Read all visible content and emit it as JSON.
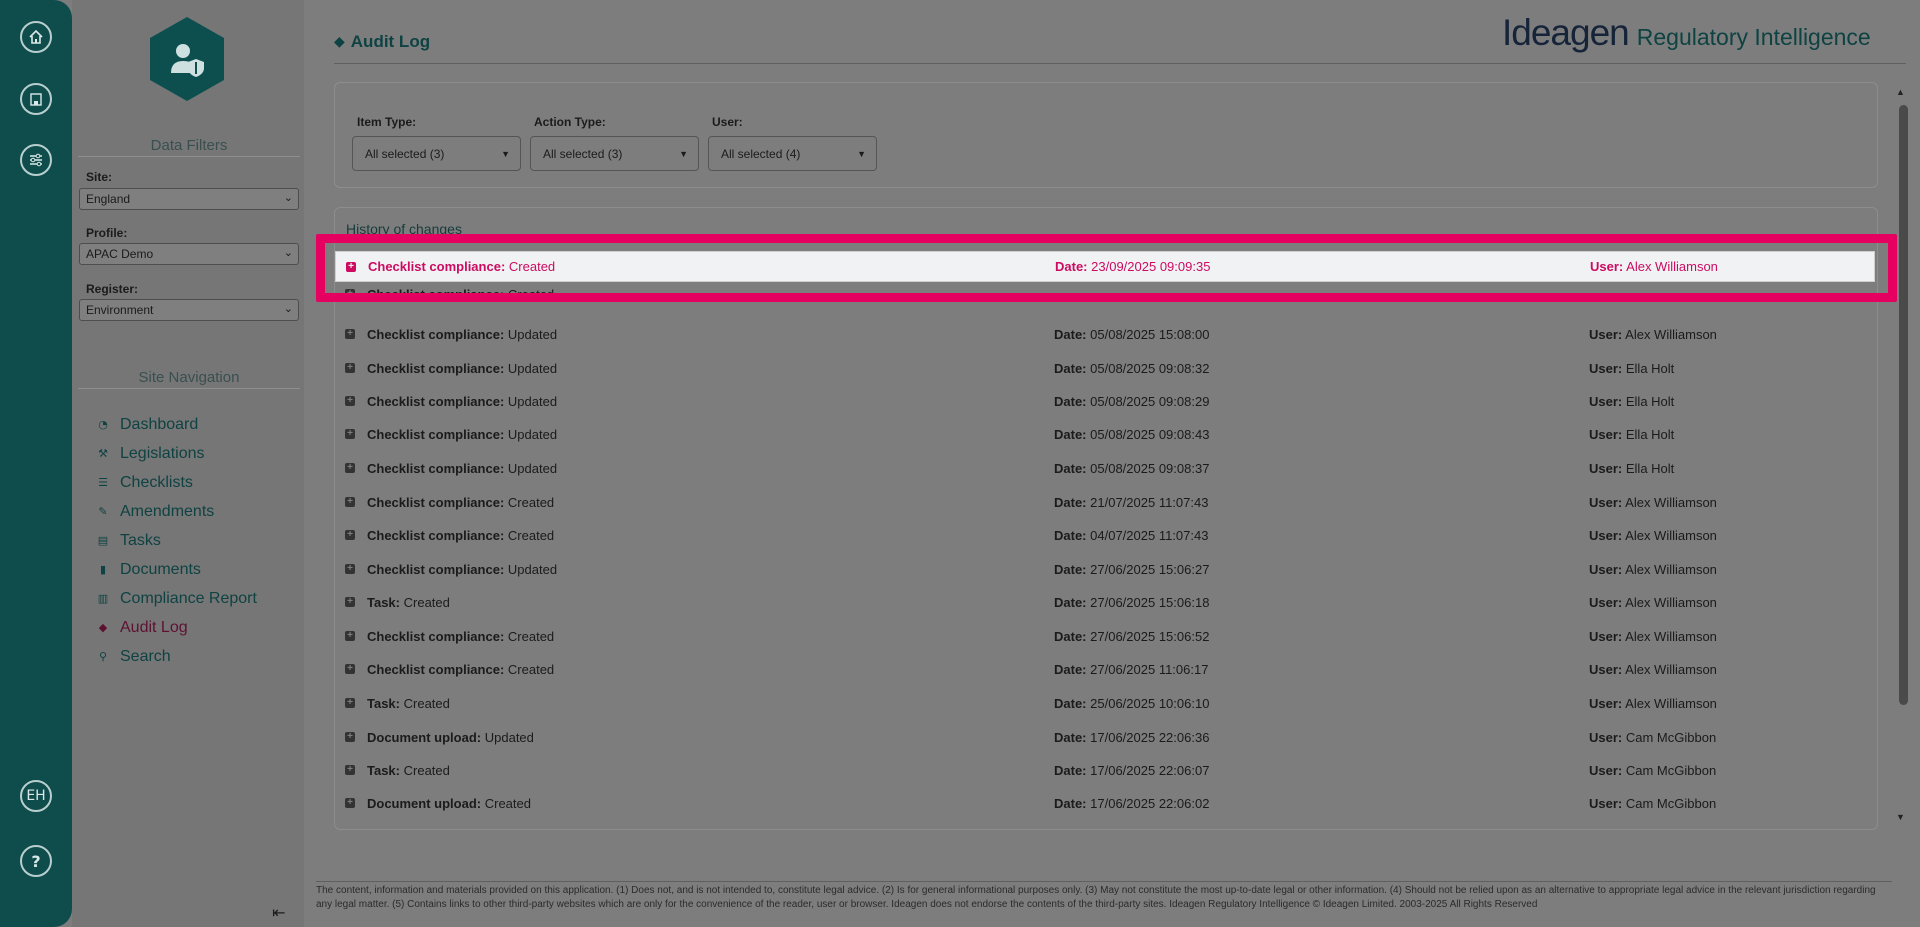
{
  "rail": {
    "home_icon": "home-icon",
    "site_icon": "building-icon",
    "filters_icon": "sliders-icon",
    "user_initials": "EH",
    "help_label": "?"
  },
  "sidebar": {
    "data_filters_title": "Data Filters",
    "site_label": "Site:",
    "site_value": "England",
    "profile_label": "Profile:",
    "profile_value": "APAC Demo",
    "register_label": "Register:",
    "register_value": "Environment",
    "nav_title": "Site Navigation",
    "nav": [
      {
        "label": "Dashboard",
        "icon": "dashboard-icon"
      },
      {
        "label": "Legislations",
        "icon": "gavel-icon"
      },
      {
        "label": "Checklists",
        "icon": "list-icon"
      },
      {
        "label": "Amendments",
        "icon": "edit-icon"
      },
      {
        "label": "Tasks",
        "icon": "tasks-icon"
      },
      {
        "label": "Documents",
        "icon": "file-icon"
      },
      {
        "label": "Compliance Report",
        "icon": "bar-chart-icon"
      },
      {
        "label": "Audit Log",
        "icon": "tags-icon"
      },
      {
        "label": "Search",
        "icon": "search-icon"
      }
    ],
    "collapse_glyph": "⇤"
  },
  "header": {
    "title": "Audit Log",
    "brand_main": "Ideagen",
    "brand_sub": "Regulatory Intelligence"
  },
  "filters": {
    "item_type_label": "Item Type:",
    "item_type_value": "All selected (3)",
    "action_type_label": "Action Type:",
    "action_type_value": "All selected (3)",
    "user_label": "User:",
    "user_value": "All selected (4)"
  },
  "history": {
    "title": "History of changes",
    "date_prefix": "Date:",
    "user_prefix": "User:",
    "rows": [
      {
        "item": "Checklist compliance:",
        "action": "Created",
        "date": "23/09/2025 09:09:35",
        "user": "Alex Williamson"
      },
      {
        "item": "Checklist compliance:",
        "action": "Created",
        "date": "",
        "user": ""
      },
      {
        "item": "Checklist compliance:",
        "action": "Updated",
        "date": "05/08/2025 15:08:00",
        "user": "Alex Williamson"
      },
      {
        "item": "Checklist compliance:",
        "action": "Updated",
        "date": "05/08/2025 09:08:32",
        "user": "Ella Holt"
      },
      {
        "item": "Checklist compliance:",
        "action": "Updated",
        "date": "05/08/2025 09:08:29",
        "user": "Ella Holt"
      },
      {
        "item": "Checklist compliance:",
        "action": "Updated",
        "date": "05/08/2025 09:08:43",
        "user": "Ella Holt"
      },
      {
        "item": "Checklist compliance:",
        "action": "Updated",
        "date": "05/08/2025 09:08:37",
        "user": "Ella Holt"
      },
      {
        "item": "Checklist compliance:",
        "action": "Created",
        "date": "21/07/2025 11:07:43",
        "user": "Alex Williamson"
      },
      {
        "item": "Checklist compliance:",
        "action": "Created",
        "date": "04/07/2025 11:07:43",
        "user": "Alex Williamson"
      },
      {
        "item": "Checklist compliance:",
        "action": "Updated",
        "date": "27/06/2025 15:06:27",
        "user": "Alex Williamson"
      },
      {
        "item": "Task:",
        "action": "Created",
        "date": "27/06/2025 15:06:18",
        "user": "Alex Williamson"
      },
      {
        "item": "Checklist compliance:",
        "action": "Created",
        "date": "27/06/2025 15:06:52",
        "user": "Alex Williamson"
      },
      {
        "item": "Checklist compliance:",
        "action": "Created",
        "date": "27/06/2025 11:06:17",
        "user": "Alex Williamson"
      },
      {
        "item": "Task:",
        "action": "Created",
        "date": "25/06/2025 10:06:10",
        "user": "Alex Williamson"
      },
      {
        "item": "Document upload:",
        "action": "Updated",
        "date": "17/06/2025 22:06:36",
        "user": "Cam McGibbon"
      },
      {
        "item": "Task:",
        "action": "Created",
        "date": "17/06/2025 22:06:07",
        "user": "Cam McGibbon"
      },
      {
        "item": "Document upload:",
        "action": "Created",
        "date": "17/06/2025 22:06:02",
        "user": "Cam McGibbon"
      }
    ]
  },
  "footer": {
    "disclaimer": "The content, information and materials provided on this application. (1) Does not, and is not intended to, constitute legal advice. (2) Is for general informational purposes only. (3) May not constitute the most up-to-date legal or other information. (4) Should not be relied upon as an alternative to appropriate legal advice in the relevant jurisdiction regarding any legal matter. (5) Contains links to other third-party websites which are only for the convenience of the reader, user or browser. Ideagen does not endorse the contents of the third-party sites. Ideagen Regulatory Intelligence © Ideagen Limited. 2003-2025 All Rights Reserved"
  },
  "colors": {
    "rail": "#0f4c4c",
    "accent_teal": "#0f4242",
    "highlight_pink": "#e6005f",
    "highlight_text": "#cc0b61",
    "active_nav": "#5d1131"
  }
}
